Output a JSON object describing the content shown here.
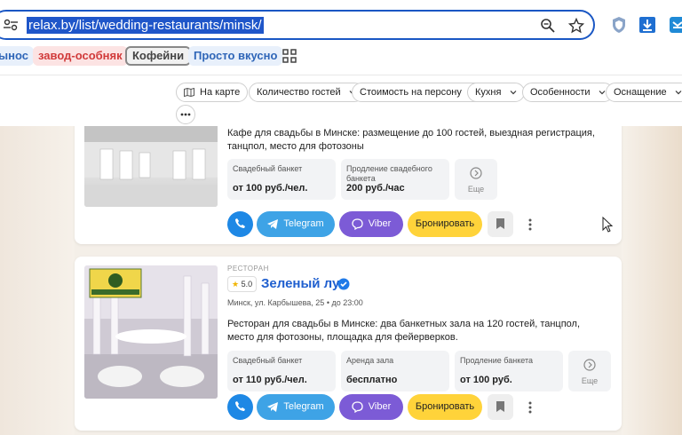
{
  "browser": {
    "url": "relax.by/list/wedding-restaurants/minsk/",
    "bookmarks": [
      "ынос",
      "завод-особняк",
      "Кофейни",
      "Просто вкусно"
    ]
  },
  "filters": {
    "map": "На карте",
    "guests": "Количество гостей",
    "price": "Стоимость на персону",
    "cuisine": "Кухня",
    "features": "Особенности",
    "equipment": "Оснащение"
  },
  "card1": {
    "description": "Кафе для свадьбы в Минске: размещение до 100 гостей, выездная регистрация, танцпол, место для фотозоны",
    "boxes": [
      {
        "label": "Свадебный банкет",
        "value": "от 100 руб./чел."
      },
      {
        "label": "Продление свадебного банкета",
        "value": "200 руб./час"
      }
    ],
    "more": "Еще",
    "buttons": {
      "telegram": "Telegram",
      "viber": "Viber",
      "book": "Бронировать"
    }
  },
  "card2": {
    "kind": "РЕСТОРАН",
    "rating": "5.0",
    "name": "Зеленый луг",
    "address": "Минск, ул. Карбышева, 25",
    "hours": "до 23:00",
    "description": "Ресторан для свадьбы в Минске: два банкетных зала на 120 гостей, танцпол, место для фотозоны, площадка для фейерверков.",
    "boxes": [
      {
        "label": "Свадебный банкет",
        "value": "от 110 руб./чел."
      },
      {
        "label": "Аренда зала",
        "value": "бесплатно"
      },
      {
        "label": "Продление банкета",
        "value": "от 100 руб."
      }
    ],
    "more": "Еще",
    "buttons": {
      "telegram": "Telegram",
      "viber": "Viber",
      "book": "Бронировать"
    }
  }
}
